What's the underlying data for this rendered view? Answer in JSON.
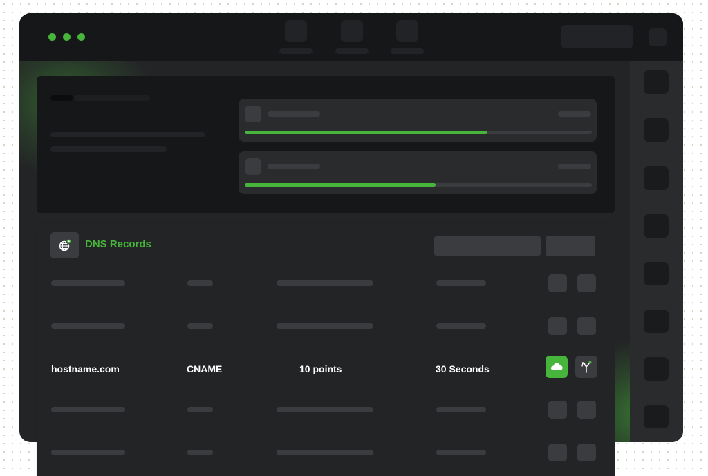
{
  "window": {
    "controls": [
      "green-dot",
      "green-dot",
      "green-dot"
    ],
    "accent_color": "#47b43b"
  },
  "overview": {
    "progress": [
      {
        "fill_fraction": 0.7
      },
      {
        "fill_fraction": 0.55
      }
    ]
  },
  "dns": {
    "title": "DNS Records",
    "icon": "globe-settings-icon",
    "rows": [
      {
        "placeholder": true
      },
      {
        "placeholder": true
      },
      {
        "placeholder": false,
        "hostname": "hostname.com",
        "type": "CNAME",
        "priority": "10 points",
        "ttl": "30 Seconds",
        "actions": [
          "cloud-icon",
          "branch-icon"
        ]
      },
      {
        "placeholder": true
      },
      {
        "placeholder": true
      }
    ]
  }
}
